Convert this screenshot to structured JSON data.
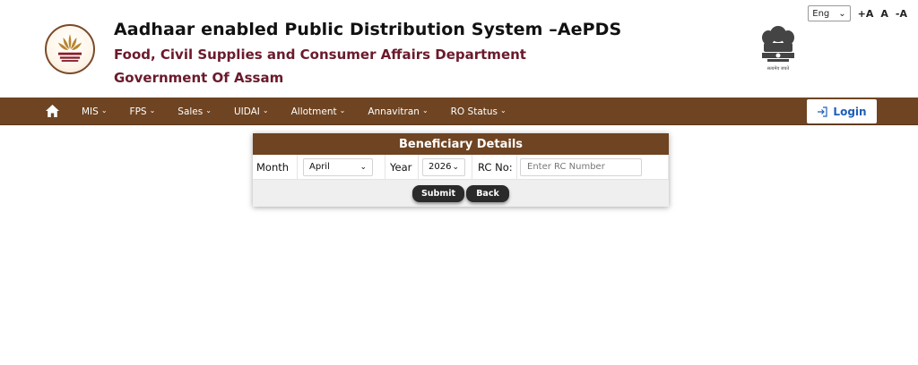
{
  "header": {
    "title": "Aadhaar enabled Public Distribution System –AePDS",
    "department": "Food, Civil Supplies and Consumer Affairs Department",
    "government": "Government Of Assam",
    "emblem_caption": "सत्यमेव जयते"
  },
  "top_tools": {
    "language": "Eng",
    "font_increase": "+A",
    "font_normal": "A",
    "font_decrease": "-A"
  },
  "nav": {
    "items": [
      {
        "label": "MIS"
      },
      {
        "label": "FPS"
      },
      {
        "label": "Sales"
      },
      {
        "label": "UIDAI"
      },
      {
        "label": "Allotment"
      },
      {
        "label": "Annavitran"
      },
      {
        "label": "RO Status"
      }
    ],
    "login_label": "Login"
  },
  "form": {
    "heading": "Beneficiary Details",
    "month_label": "Month",
    "month_value": "April",
    "year_label": "Year",
    "year_value": "2026",
    "rc_label": "RC No:",
    "rc_placeholder": "Enter RC Number",
    "submit_label": "Submit",
    "back_label": "Back"
  },
  "colors": {
    "brand_brown": "#6f4422",
    "dept_maroon": "#6b1a2c",
    "login_blue": "#1f5fb8"
  }
}
